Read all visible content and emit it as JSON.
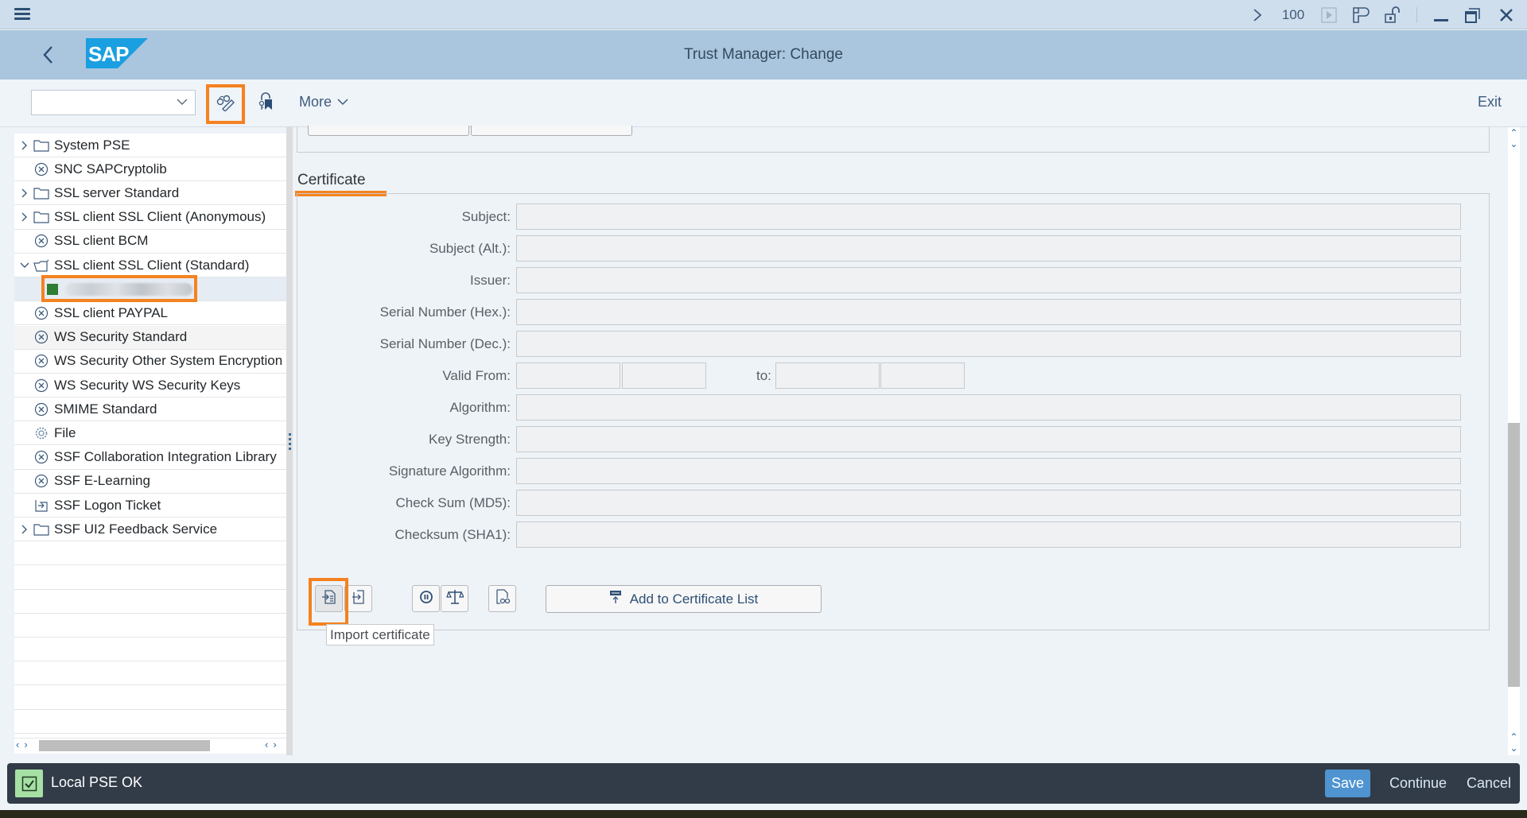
{
  "system_bar": {
    "zoom_level": "100",
    "icons": [
      "menu-icon",
      "chevron-right-icon",
      "play-icon",
      "layout-icon",
      "unlock-icon",
      "minimize-icon",
      "restore-icon",
      "close-icon"
    ]
  },
  "header": {
    "title": "Trust Manager: Change",
    "logo_text": "SAP"
  },
  "toolbar": {
    "command_field_value": "",
    "more_label": "More",
    "exit_label": "Exit",
    "icons": [
      "display-change-icon",
      "key-lock-icon"
    ]
  },
  "tree": {
    "items": [
      {
        "label": "System PSE",
        "type": "folder",
        "expandable": true,
        "expanded": false
      },
      {
        "label": "SNC SAPCryptolib",
        "type": "error"
      },
      {
        "label": "SSL server Standard",
        "type": "folder",
        "expandable": true,
        "expanded": false
      },
      {
        "label": "SSL client SSL Client (Anonymous)",
        "type": "folder",
        "expandable": true,
        "expanded": false
      },
      {
        "label": "SSL client BCM",
        "type": "error"
      },
      {
        "label": "SSL client SSL Client (Standard)",
        "type": "folder-open",
        "expandable": true,
        "expanded": true
      },
      {
        "label": "",
        "type": "certificate-node",
        "selected": true,
        "blurred": true
      },
      {
        "label": "SSL client PAYPAL",
        "type": "error"
      },
      {
        "label": "WS Security Standard",
        "type": "error"
      },
      {
        "label": "WS Security Other System Encryption",
        "type": "error"
      },
      {
        "label": "WS Security WS Security Keys",
        "type": "error"
      },
      {
        "label": "SMIME Standard",
        "type": "error"
      },
      {
        "label": "File",
        "type": "gear"
      },
      {
        "label": "SSF Collaboration Integration Library",
        "type": "error"
      },
      {
        "label": "SSF E-Learning",
        "type": "error"
      },
      {
        "label": "SSF Logon Ticket",
        "type": "ticket"
      },
      {
        "label": "SSF UI2 Feedback Service",
        "type": "folder",
        "expandable": true,
        "expanded": false
      }
    ]
  },
  "certificate": {
    "section_title": "Certificate",
    "fields": [
      {
        "label": "Subject:",
        "value": ""
      },
      {
        "label": "Subject (Alt.):",
        "value": ""
      },
      {
        "label": "Issuer:",
        "value": ""
      },
      {
        "label": "Serial Number (Hex.):",
        "value": ""
      },
      {
        "label": "Serial Number (Dec.):",
        "value": ""
      },
      {
        "label": "Valid From:",
        "value": ""
      },
      {
        "label": "Algorithm:",
        "value": ""
      },
      {
        "label": "Key Strength:",
        "value": ""
      },
      {
        "label": "Signature Algorithm:",
        "value": ""
      },
      {
        "label": "Check Sum (MD5):",
        "value": ""
      },
      {
        "label": "Checksum (SHA1):",
        "value": ""
      }
    ],
    "valid_from_date": "",
    "valid_from_time": "",
    "valid_to_label": "to:",
    "valid_to_date": "",
    "valid_to_time": "",
    "buttons": {
      "import_icon": "import-certificate-icon",
      "export_icon": "export-certificate-icon",
      "pause_icon": "pause-icon",
      "compare_icon": "balance-scale-icon",
      "display_icon": "display-document-icon",
      "add_to_list_label": "Add to Certificate List"
    },
    "tooltip": "Import certificate"
  },
  "status_bar": {
    "message": "Local PSE OK",
    "status": "success",
    "save_label": "Save",
    "continue_label": "Continue",
    "cancel_label": "Cancel"
  },
  "colors": {
    "highlight": "#f58220",
    "header_bg": "#a9c6de",
    "system_bar_bg": "#cfdeec",
    "status_bar_bg": "#323c48",
    "primary_button": "#4f93d1",
    "success_bg": "#a6e0a5"
  }
}
